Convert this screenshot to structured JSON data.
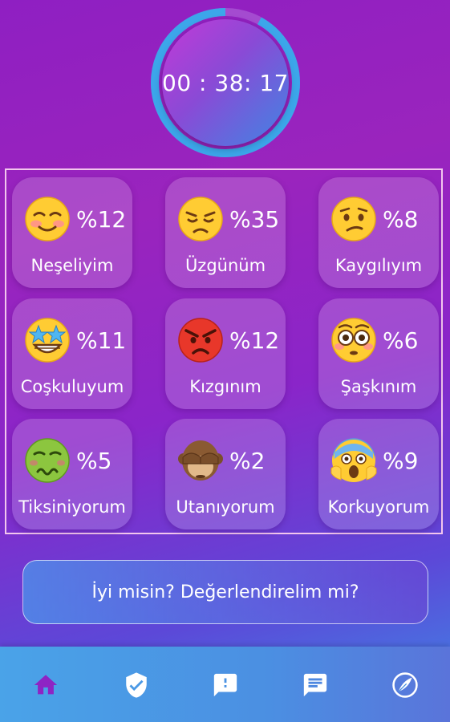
{
  "timer": {
    "text": "00 : 38: 17",
    "progress_fraction": 0.92
  },
  "moods": [
    {
      "emoji_icon": "smiling-blush-emoji",
      "percent": "%12",
      "label": "Neşeliyim"
    },
    {
      "emoji_icon": "disappointed-face-emoji",
      "percent": "%35",
      "label": "Üzgünüm"
    },
    {
      "emoji_icon": "confused-face-emoji",
      "percent": "%8",
      "label": "Kaygılıyım"
    },
    {
      "emoji_icon": "star-struck-emoji",
      "percent": "%11",
      "label": "Coşkuluyum"
    },
    {
      "emoji_icon": "angry-face-emoji",
      "percent": "%12",
      "label": "Kızgınım"
    },
    {
      "emoji_icon": "flushed-face-emoji",
      "percent": "%6",
      "label": "Şaşkınım"
    },
    {
      "emoji_icon": "nauseated-face-emoji",
      "percent": "%5",
      "label": "Tiksiniyorum"
    },
    {
      "emoji_icon": "see-no-evil-monkey-emoji",
      "percent": "%2",
      "label": "Utanıyorum"
    },
    {
      "emoji_icon": "screaming-face-emoji",
      "percent": "%9",
      "label": "Korkuyorum"
    }
  ],
  "prompt": {
    "label": "İyi misin? Değerlendirelim mi?"
  },
  "nav": [
    {
      "icon": "home-icon",
      "active": true
    },
    {
      "icon": "shield-check-icon",
      "active": false
    },
    {
      "icon": "alert-message-icon",
      "active": false
    },
    {
      "icon": "chat-icon",
      "active": false
    },
    {
      "icon": "feather-logo-icon",
      "active": false
    }
  ],
  "colors": {
    "nav_active": "#8e24c4",
    "nav_inactive": "#ffffff"
  }
}
